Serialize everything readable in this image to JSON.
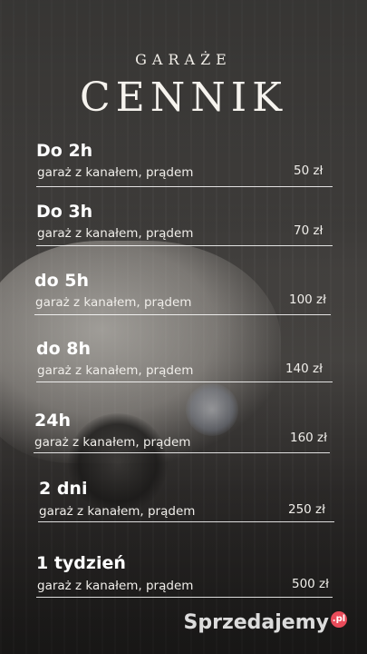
{
  "header": {
    "brand": "GARAŻE",
    "title": "CENNIK"
  },
  "pricelist": {
    "items": [
      {
        "name": "Do 2h",
        "desc": "garaż z kanałem, prądem",
        "price": "50 zł"
      },
      {
        "name": "Do 3h",
        "desc": "garaż z kanałem, prądem",
        "price": "70 zł"
      },
      {
        "name": "do 5h",
        "desc": "garaż z kanałem, prądem",
        "price": "100 zł"
      },
      {
        "name": "do 8h",
        "desc": "garaż z kanałem, prądem",
        "price": "140 zł"
      },
      {
        "name": "24h",
        "desc": "garaż z kanałem, prądem",
        "price": "160 zł"
      },
      {
        "name": "2 dni",
        "desc": "garaż z kanałem, prądem",
        "price": "250 zł"
      },
      {
        "name": "1 tydzień",
        "desc": "garaż z kanałem, prądem",
        "price": "500 zł"
      }
    ]
  },
  "watermark": {
    "text": "Sprzedajemy",
    "suffix": ".pl"
  },
  "colors": {
    "accent": "#e94b5a",
    "text": "#ffffff"
  }
}
